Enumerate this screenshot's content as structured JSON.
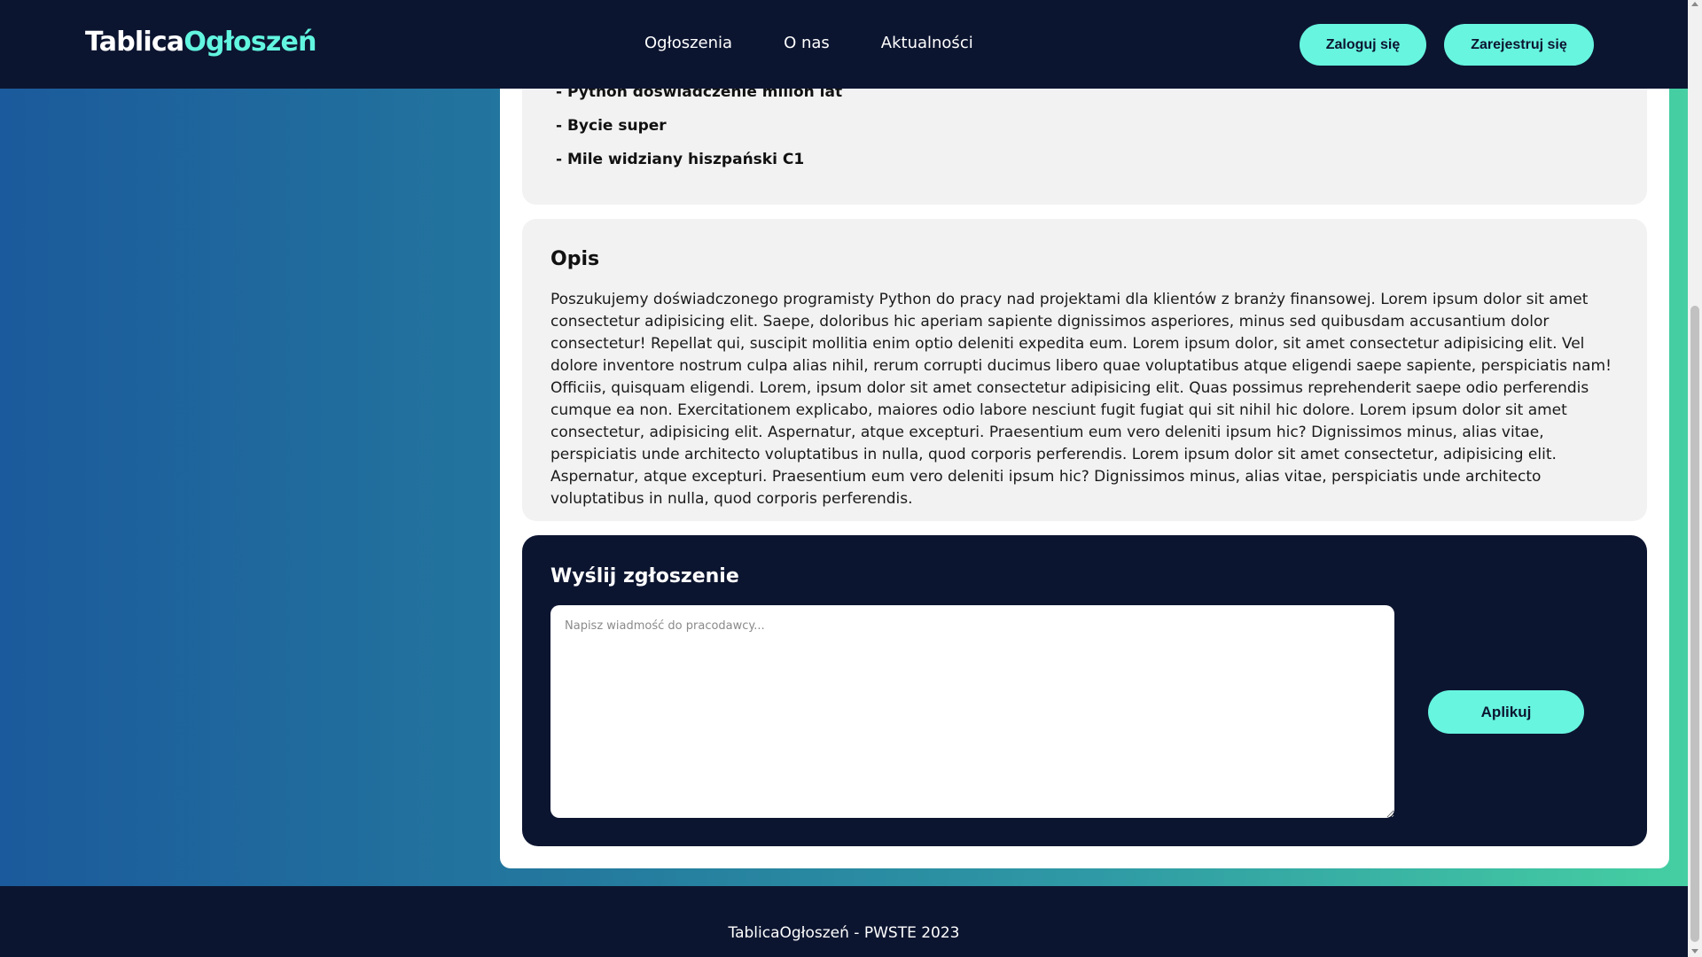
{
  "header": {
    "logo_part1": "Tablica",
    "logo_part2": "Ogłoszeń",
    "nav": [
      "Ogłoszenia",
      "O nas",
      "Aktualności"
    ],
    "login_label": "Zaloguj się",
    "register_label": "Zarejestruj się"
  },
  "requirements": [
    "- Python doświadczenie milion lat",
    "- Bycie super",
    "- Mile widziany hiszpański C1"
  ],
  "description": {
    "title": "Opis",
    "text": "Poszukujemy doświadczonego programisty Python do pracy nad projektami dla klientów z branży finansowej. Lorem ipsum dolor sit amet consectetur adipisicing elit. Saepe, doloribus hic aperiam sapiente dignissimos asperiores, minus sed quibusdam accusantium dolor consectetur! Repellat qui, suscipit mollitia enim optio deleniti expedita eum. Lorem ipsum dolor, sit amet consectetur adipisicing elit. Vel dolore inventore nostrum culpa alias nihil, rerum corrupti ducimus libero quae voluptatibus atque eligendi saepe sapiente, perspiciatis nam! Officiis, quisquam eligendi. Lorem, ipsum dolor sit amet consectetur adipisicing elit. Quas possimus reprehenderit saepe odio perferendis cumque ea non. Exercitationem explicabo, maiores odio labore nesciunt fugit fugiat qui sit nihil hic dolore. Lorem ipsum dolor sit amet consectetur, adipisicing elit. Aspernatur, atque excepturi. Praesentium eum vero deleniti ipsum hic? Dignissimos minus, alias vitae, perspiciatis unde architecto voluptatibus in nulla, quod corporis perferendis. Lorem ipsum dolor sit amet consectetur, adipisicing elit. Aspernatur, atque excepturi. Praesentium eum vero deleniti ipsum hic? Dignissimos minus, alias vitae, perspiciatis unde architecto voluptatibus in nulla, quod corporis perferendis."
  },
  "application": {
    "title": "Wyślij zgłoszenie",
    "message_placeholder": "Napisz wiadmość do pracodawcy...",
    "message_value": "",
    "apply_label": "Aplikuj"
  },
  "footer": {
    "text": "TablicaOgłoszeń - PWSTE 2023"
  },
  "colors": {
    "navy": "#0c1530",
    "accent": "#67f5df",
    "card_gray": "#f2f2f2"
  }
}
